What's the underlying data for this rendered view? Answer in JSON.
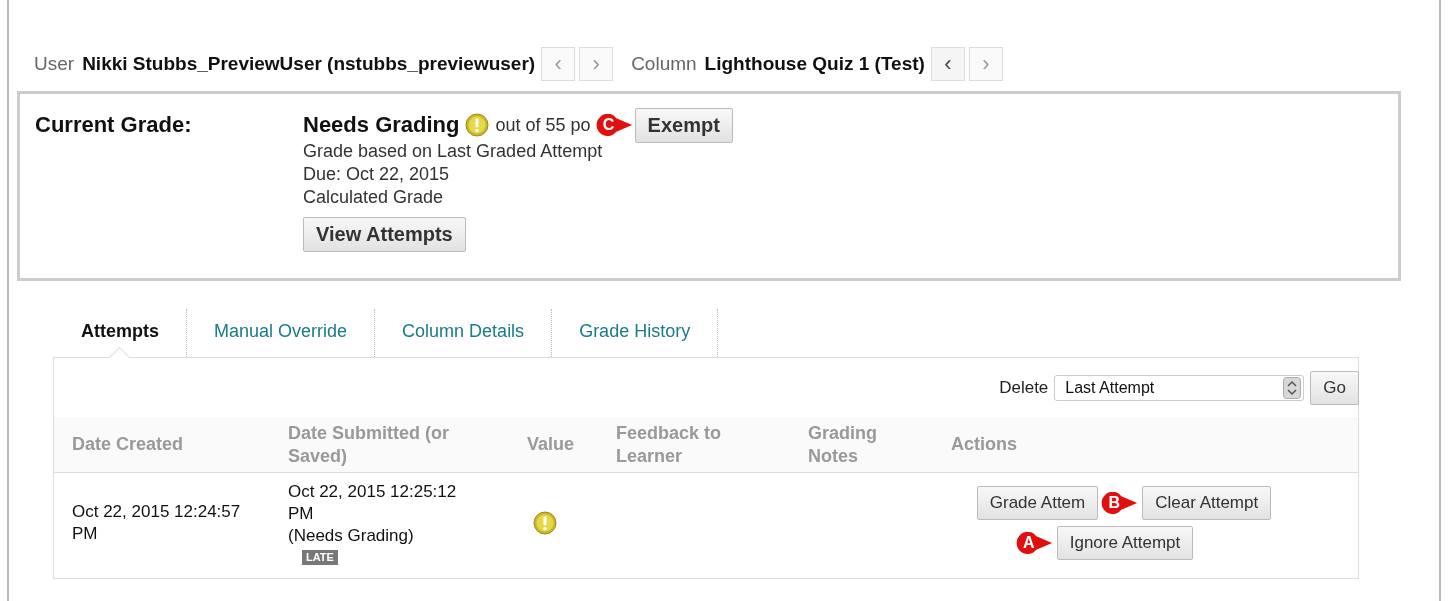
{
  "header": {
    "user_label": "User",
    "user_value": "Nikki Stubbs_PreviewUser (nstubbs_previewuser)",
    "column_label": "Column",
    "column_value": "Lighthouse Quiz 1 (Test)",
    "user_nav": [
      {
        "glyph": "‹",
        "disabled": true
      },
      {
        "glyph": "›",
        "disabled": true
      }
    ],
    "column_nav": [
      {
        "glyph": "‹",
        "disabled": false
      },
      {
        "glyph": "›",
        "disabled": true
      }
    ]
  },
  "current_grade": {
    "label": "Current Grade:",
    "status": "Needs Grading",
    "out_of": "out of 55 po",
    "exempt_button": {
      "label": "Exempt",
      "callout": "C"
    },
    "lines": [
      "Grade based on Last Graded Attempt",
      "Due: Oct 22, 2015",
      "Calculated Grade"
    ],
    "view_button": "View Attempts"
  },
  "tabs": [
    {
      "label": "Attempts",
      "selected": true
    },
    {
      "label": "Manual Override",
      "selected": false
    },
    {
      "label": "Column Details",
      "selected": false
    },
    {
      "label": "Grade History",
      "selected": false
    }
  ],
  "delete": {
    "label": "Delete",
    "value": "Last Attempt",
    "go": "Go"
  },
  "table": {
    "columns": [
      "Date Created",
      "Date Submitted (or Saved)",
      "Value",
      "Feedback to Learner",
      "Grading Notes",
      "Actions"
    ],
    "rows": [
      {
        "created": "Oct 22, 2015 12:24:57 PM",
        "submitted": "Oct 22, 2015 12:25:12 PM",
        "submitted_note": "(Needs Grading)",
        "late_badge": "LATE",
        "actions": [
          {
            "label": "Grade Attem"
          },
          {
            "label": "Clear Attempt",
            "callout": "B"
          },
          {
            "label": "Ignore Attempt",
            "callout": "A"
          }
        ]
      }
    ]
  }
}
